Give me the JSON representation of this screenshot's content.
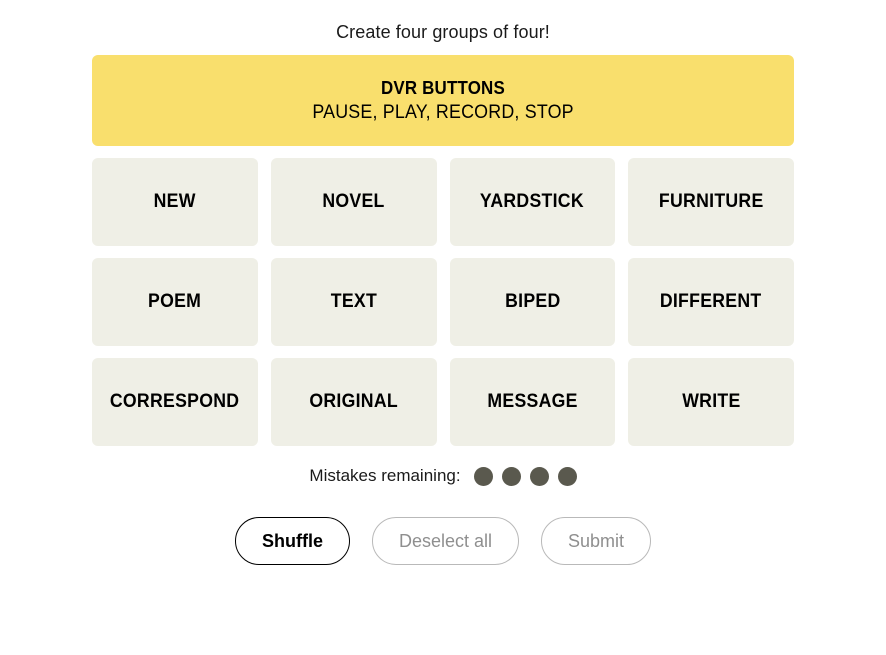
{
  "game": {
    "instruction": "Create four groups of four!"
  },
  "solved_groups": [
    {
      "title": "DVR BUTTONS",
      "members": "PAUSE, PLAY, RECORD, STOP",
      "color": "#F9DF6D"
    }
  ],
  "grid": {
    "rows": [
      {
        "tiles": [
          {
            "label": "NEW"
          },
          {
            "label": "NOVEL"
          },
          {
            "label": "YARDSTICK"
          },
          {
            "label": "FURNITURE"
          }
        ]
      },
      {
        "tiles": [
          {
            "label": "POEM"
          },
          {
            "label": "TEXT"
          },
          {
            "label": "BIPED"
          },
          {
            "label": "DIFFERENT"
          }
        ]
      },
      {
        "tiles": [
          {
            "label": "CORRESPOND"
          },
          {
            "label": "ORIGINAL"
          },
          {
            "label": "MESSAGE"
          },
          {
            "label": "WRITE"
          }
        ]
      }
    ],
    "tile_color": "#EFEFE6"
  },
  "mistakes": {
    "label": "Mistakes remaining:",
    "remaining": 4,
    "dot_color": "#5A594E"
  },
  "controls": {
    "shuffle_label": "Shuffle",
    "deselect_label": "Deselect all",
    "submit_label": "Submit"
  }
}
